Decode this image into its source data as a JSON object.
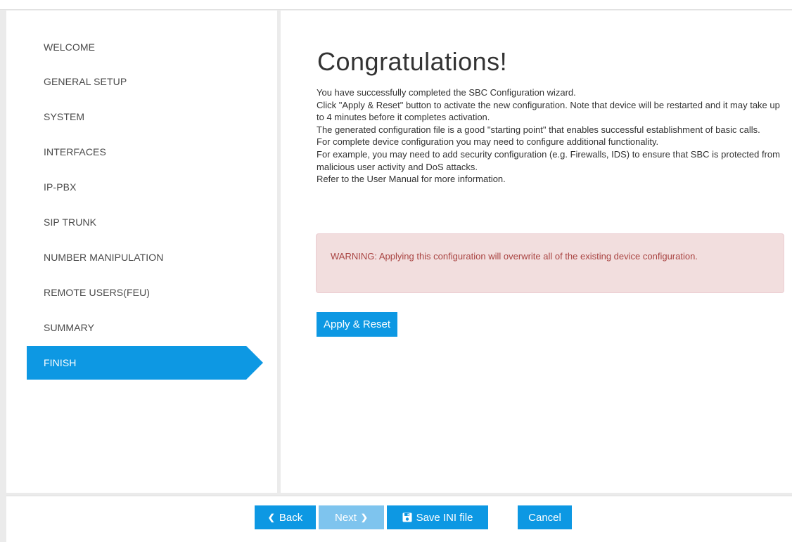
{
  "sidebar": {
    "items": [
      {
        "label": "WELCOME"
      },
      {
        "label": "GENERAL SETUP"
      },
      {
        "label": "SYSTEM"
      },
      {
        "label": "INTERFACES"
      },
      {
        "label": "IP-PBX"
      },
      {
        "label": "SIP TRUNK"
      },
      {
        "label": "NUMBER MANIPULATION"
      },
      {
        "label": "REMOTE USERS(FEU)"
      },
      {
        "label": "SUMMARY"
      },
      {
        "label": "FINISH",
        "active": true
      }
    ]
  },
  "main": {
    "title": "Congratulations!",
    "paragraphs": [
      "You have successfully completed the SBC Configuration wizard.",
      "Click \"Apply & Reset\" button to activate the new configuration. Note that device will be restarted and it may take up to 4 minutes before it completes activation.",
      "The generated configuration file is a good \"starting point\" that enables successful establishment of basic calls.",
      "For complete device configuration you may need to configure additional functionality.",
      "For example, you may need to add security configuration (e.g. Firewalls, IDS) to ensure that SBC is protected from malicious user activity and DoS attacks.",
      "Refer to the User Manual for more information."
    ],
    "warning": "WARNING: Applying this configuration will overwrite all of the existing device configuration.",
    "apply_label": "Apply & Reset"
  },
  "footer": {
    "back_label": "Back",
    "next_label": "Next",
    "save_label": "Save INI file",
    "cancel_label": "Cancel"
  },
  "colors": {
    "accent": "#0d98e3",
    "warning_bg": "#f2dede",
    "warning_text": "#a94442"
  },
  "icons": {
    "back": "chevron-left-icon",
    "next": "chevron-right-icon",
    "save": "floppy-disk-icon"
  }
}
